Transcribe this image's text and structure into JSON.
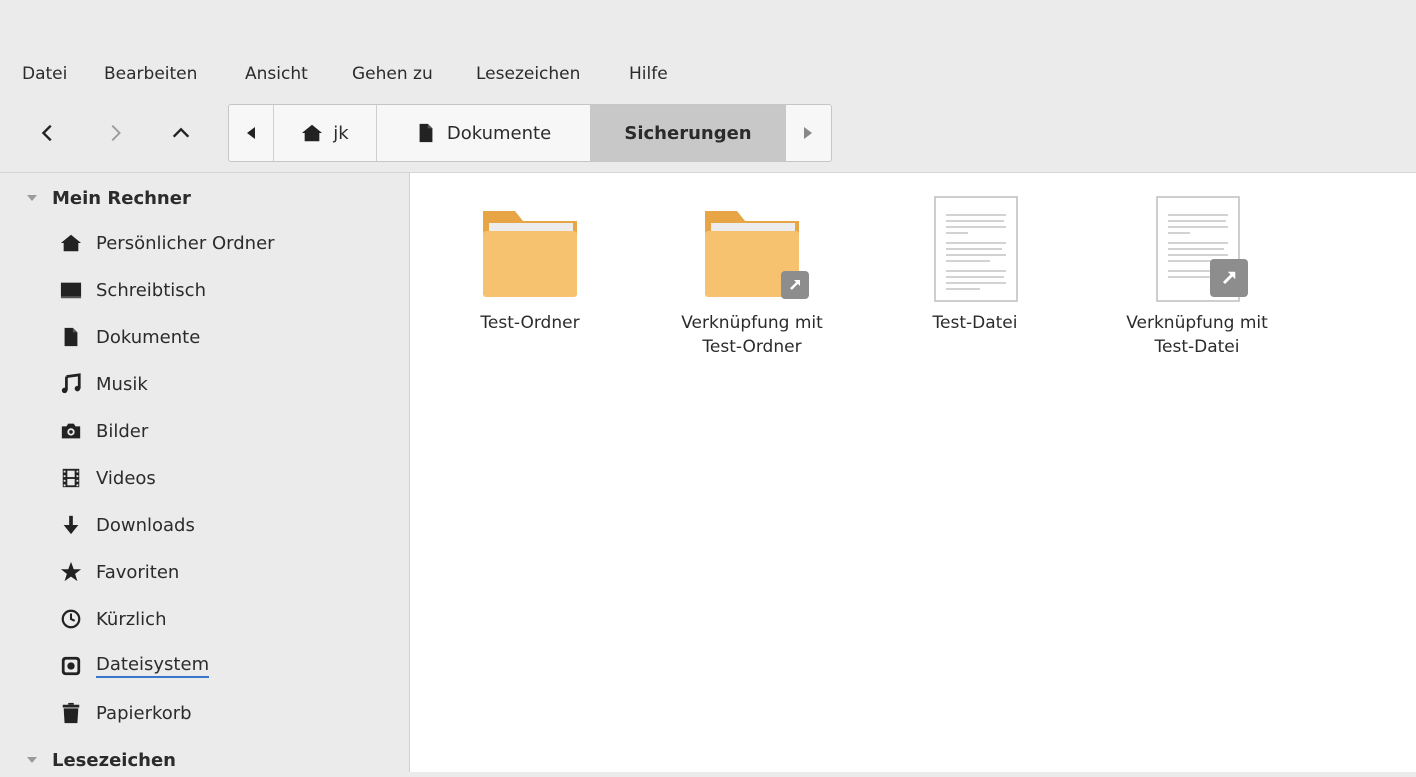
{
  "menu": {
    "file": "Datei",
    "edit": "Bearbeiten",
    "view": "Ansicht",
    "go": "Gehen zu",
    "bookmarks": "Lesezeichen",
    "help": "Hilfe"
  },
  "toolbar": {
    "back_icon": "chevron-left-icon",
    "forward_icon": "chevron-right-icon",
    "up_icon": "chevron-up-icon"
  },
  "pathbar": {
    "crumbs": [
      {
        "label": "jk",
        "icon": "home-icon"
      },
      {
        "label": "Dokumente",
        "icon": "document-icon"
      },
      {
        "label": "Sicherungen",
        "active": true
      }
    ]
  },
  "sidebar": {
    "sections": [
      {
        "title": "Mein Rechner",
        "items": [
          {
            "label": "Persönlicher Ordner",
            "icon": "home-icon"
          },
          {
            "label": "Schreibtisch",
            "icon": "desktop-icon"
          },
          {
            "label": "Dokumente",
            "icon": "document-icon"
          },
          {
            "label": "Musik",
            "icon": "music-icon"
          },
          {
            "label": "Bilder",
            "icon": "camera-icon"
          },
          {
            "label": "Videos",
            "icon": "film-icon"
          },
          {
            "label": "Downloads",
            "icon": "download-icon"
          },
          {
            "label": "Favoriten",
            "icon": "star-icon"
          },
          {
            "label": "Kürzlich",
            "icon": "clock-icon"
          },
          {
            "label": "Dateisystem",
            "icon": "drive-icon"
          },
          {
            "label": "Papierkorb",
            "icon": "trash-icon"
          }
        ]
      },
      {
        "title": "Lesezeichen",
        "items": []
      }
    ]
  },
  "files": [
    {
      "label": "Test-Ordner",
      "type": "folder",
      "link": false
    },
    {
      "label": "Verknüpfung mit\nTest-Ordner",
      "type": "folder",
      "link": true
    },
    {
      "label": "Test-Datei",
      "type": "text",
      "link": false
    },
    {
      "label": "Verknüpfung mit\nTest-Datei",
      "type": "text",
      "link": true
    }
  ],
  "colors": {
    "folder": "#f6c26f",
    "folder_tab": "#e7a545",
    "link_badge": "#8d8d8d",
    "active_crumb": "#c8c8c8",
    "accent_underline": "#3a77c9"
  }
}
